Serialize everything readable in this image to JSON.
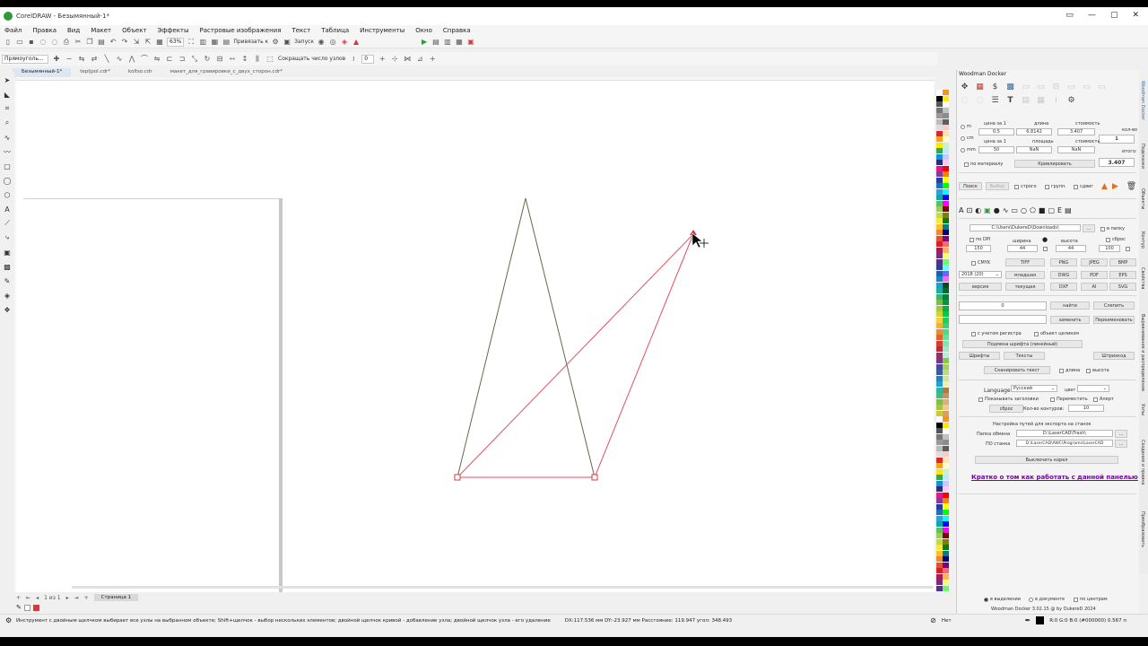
{
  "window": {
    "title": "CorelDRAW - Безымянный-1*",
    "controls": [
      "▭",
      "—",
      "▢",
      "✕"
    ]
  },
  "menu": [
    "Файл",
    "Правка",
    "Вид",
    "Макет",
    "Объект",
    "Эффекты",
    "Растровые изображения",
    "Текст",
    "Таблица",
    "Инструменты",
    "Окно",
    "Справка"
  ],
  "toolbar": {
    "zoom": "63%",
    "snap_label": "Привязать к",
    "launch_label": "Запуск"
  },
  "property_bar": {
    "tool_mode": "Прямоуголь...",
    "reduce_nodes": "Сокращать число узлов",
    "nodes_count": "0"
  },
  "doc_tabs": [
    "Безымянный-1*",
    "tepljpol.cdr*",
    "koltso.cdr",
    "макет_для_гравировки_с_двух_сторон.cdr*"
  ],
  "pages": {
    "counter": "1 из 1",
    "current_page": "Страница 1"
  },
  "docker": {
    "title": "Woodman Docker",
    "units": [
      "m",
      "cm",
      "mm"
    ],
    "price_label_1": "цена за 1",
    "length_label": "длина",
    "cost_label": "стоимость",
    "count_label": "кол-во",
    "price_1": "0.5",
    "length": "6.8142",
    "cost": "3.407",
    "count": "1",
    "price_label_2": "цена за 1",
    "area_label": "площадь",
    "cost_label_2": "стоимость",
    "total_label": "итого:",
    "price_2": "50",
    "area": "NaN",
    "cost_2": "NaN",
    "total": "3.407",
    "by_material": "по материалу",
    "curve_btn": "Кривлировать",
    "search_btn": "Поиск",
    "select_btn": "Выбор",
    "strict": "строго",
    "group": "групп.",
    "flag": "сдвиг",
    "path": "C:\\Users\\DukereD\\Downloads\\",
    "browse": "...",
    "to_folder": "в папку",
    "dpi_label": "по DPI",
    "width_label": "ширина",
    "height_label": "высота",
    "reset_label": "сброс",
    "dpi": "150",
    "width": "44",
    "height": "44",
    "quality": "100",
    "cmyk": "CMYK",
    "tiff": "TIFF",
    "png": "PNG",
    "jpeg": "JPEG",
    "bmp": "BMP",
    "version": "2018 (20)",
    "older": "младшая",
    "dwg": "DWG",
    "pdf": "PDF",
    "eps": "EPS",
    "version_btn": "версия",
    "current": "текущая",
    "dxf": "DXF",
    "ai": "AI",
    "svg": "SVG",
    "find_value": "0",
    "find_btn": "найти",
    "merge_btn": "Слепить",
    "replace_btn": "заменить",
    "rename_btn": "Переименовать",
    "case": "с учетом регистра",
    "whole_object": "объект целиком",
    "font_sub": "Подмена шрифта (линейный)",
    "fonts_btn": "Шрифты",
    "texts_btn": "Тексты",
    "stroke_btn": "Штрихкод",
    "scan_text": "Сканировать текст",
    "length_cb": "длина",
    "height_cb": "высота",
    "language_label": "Language",
    "language": "Русский",
    "color_label": "цвет",
    "show_headers": "Показывать заголовки",
    "move": "Переместить",
    "alert": "Алерт",
    "reset_btn": "сброс",
    "contours_label": "Кол-во контуров:",
    "contours": "10",
    "export_title": "Настройка путей для экспорта на станок",
    "exchange_label": "Папка обмена",
    "exchange_path": "D:\\LaserCAD\\Trash\\",
    "machine_label": "ПО станка",
    "machine_path": "D:\\LaserCAD\\AWC\\Programs\\LaserCAD",
    "close_btn": "Выключить корел",
    "help_link": "Кратко о том как работать с данной панелью",
    "in_selection": "в выделении",
    "in_document": "в документе",
    "by_center": "по центрам",
    "footer": "Woodman Docker 3.02.15 @ by DukereD 2024"
  },
  "side_tabs": [
    "Woodman Docker",
    "Подсказки",
    "Объекты",
    "Контур",
    "Свойства",
    "Выравнивание и распределение",
    "Узлы",
    "Создание и правка",
    "Преобразовать"
  ],
  "status": {
    "hint": "Инструмент с двойным щелчком выбирает все узлы на выбранном объекте; Shift+щелчок - выбор нескольких элементов; двойной щелчок кривой - добавление узла; двойной щелчок узла - его удаление",
    "coords": "DX:117.536 мм DY:-23.927 мм Расстояние: 119.947 угол: 348.493",
    "fill_none": "Нет",
    "outline": "R:0 G:0 B:0 (#000000)  0.567 п"
  },
  "colors": {
    "accent": "#1e73be",
    "red": "#d63b3b",
    "link": "#7a00a8",
    "stroke": "#6b6446",
    "red_stroke": "#e05060"
  }
}
